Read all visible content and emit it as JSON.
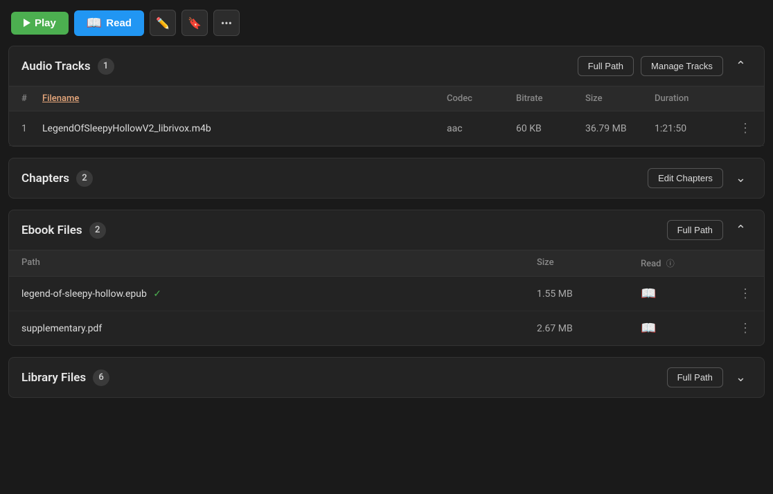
{
  "toolbar": {
    "play_label": "Play",
    "read_label": "Read"
  },
  "audio_tracks": {
    "title": "Audio Tracks",
    "count": 1,
    "full_path_label": "Full Path",
    "manage_tracks_label": "Manage Tracks",
    "columns": {
      "number": "#",
      "filename": "Filename",
      "codec": "Codec",
      "bitrate": "Bitrate",
      "size": "Size",
      "duration": "Duration"
    },
    "tracks": [
      {
        "number": "1",
        "filename": "LegendOfSleepyHollowV2_librivox.m4b",
        "codec": "aac",
        "bitrate": "60 KB",
        "size": "36.79 MB",
        "duration": "1:21:50"
      }
    ]
  },
  "chapters": {
    "title": "Chapters",
    "count": 2,
    "edit_chapters_label": "Edit Chapters"
  },
  "ebook_files": {
    "title": "Ebook Files",
    "count": 2,
    "full_path_label": "Full Path",
    "columns": {
      "path": "Path",
      "size": "Size",
      "read": "Read"
    },
    "files": [
      {
        "path": "legend-of-sleepy-hollow.epub",
        "verified": true,
        "size": "1.55 MB"
      },
      {
        "path": "supplementary.pdf",
        "verified": false,
        "size": "2.67 MB"
      }
    ]
  },
  "library_files": {
    "title": "Library Files",
    "count": 6,
    "full_path_label": "Full Path"
  }
}
